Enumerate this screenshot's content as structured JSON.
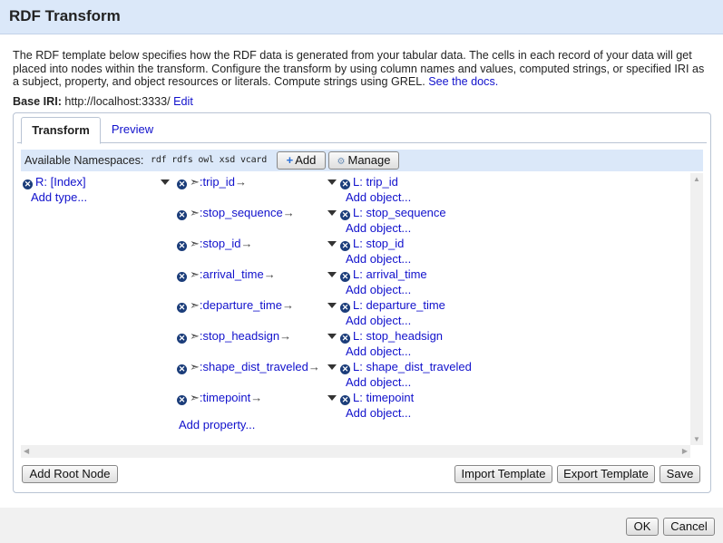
{
  "dialog": {
    "title": "RDF Transform",
    "description": "The RDF template below specifies how the RDF data is generated from your tabular data. The cells in each record of your data will get placed into nodes within the transform. Configure the transform by using column names and values, computed strings, or specified IRI as a subject, property, and object resources or literals. Compute strings using GREL.",
    "docs_link": "See the docs.",
    "base_iri_label": "Base IRI:",
    "base_iri_value": "http://localhost:3333/",
    "base_iri_edit": "Edit"
  },
  "tabs": [
    {
      "label": "Transform",
      "active": true
    },
    {
      "label": "Preview",
      "active": false
    }
  ],
  "namespaces": {
    "label": "Available Namespaces:",
    "list": "rdf rdfs owl xsd vcard",
    "add_label": "Add",
    "manage_label": "Manage"
  },
  "subject": {
    "label": "R: [Index]",
    "add_type": "Add type..."
  },
  "properties": [
    {
      "name": ":trip_id",
      "object": "L: trip_id"
    },
    {
      "name": ":stop_sequence",
      "object": "L: stop_sequence"
    },
    {
      "name": ":stop_id",
      "object": "L: stop_id"
    },
    {
      "name": ":arrival_time",
      "object": "L: arrival_time"
    },
    {
      "name": ":departure_time",
      "object": "L: departure_time"
    },
    {
      "name": ":stop_headsign",
      "object": "L: stop_headsign"
    },
    {
      "name": ":shape_dist_traveled",
      "object": "L: shape_dist_traveled"
    },
    {
      "name": ":timepoint",
      "object": "L: timepoint"
    }
  ],
  "add_object": "Add object...",
  "add_property": "Add property...",
  "buttons": {
    "add_root": "Add Root Node",
    "import_template": "Import Template",
    "export_template": "Export Template",
    "save": "Save",
    "ok": "OK",
    "cancel": "Cancel"
  }
}
